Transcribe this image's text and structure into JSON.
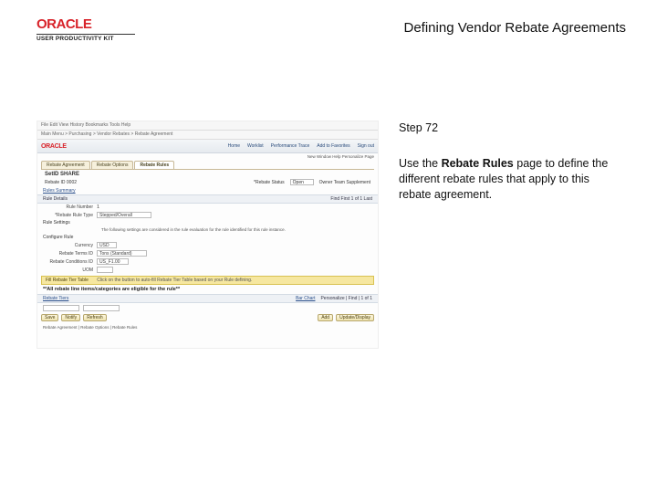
{
  "header": {
    "logo_text": "ORACLE",
    "upk_text": "USER PRODUCTIVITY KIT",
    "title": "Defining Vendor Rebate Agreements"
  },
  "instruction": {
    "step": "Step 72",
    "p1": "Use the ",
    "bold": "Rebate Rules",
    "p2": " page to define the different rebate rules that apply to this rebate agreement."
  },
  "app": {
    "menubar": "File   Edit   View   History   Bookmarks   Tools   Help",
    "breadcrumb": "Main Menu  >  Purchasing  >  Vendor Rebates  >  Rebate Agreement",
    "nav": [
      "Home",
      "Worklist",
      "Performance Trace",
      "Add to Favorites",
      "Sign out"
    ],
    "user_line": "New Window   Help   Personalize Page",
    "tabs": [
      "Rebate Agreement",
      "Rebate Options",
      "Rebate Rules"
    ],
    "edit_title": "SetID SHARE",
    "rebate_id": "Rebate ID  0002",
    "status_label": "*Rebate Status",
    "status_value": "Open",
    "origin_value": "Owner Team Supplement",
    "rules_summary": "Rules Summary",
    "rule_details": "Rule Details",
    "details_right": "Find   First   1 of 1   Last",
    "rule_number_label": "Rule Number",
    "rule_number_value": "1",
    "rule_type_label": "*Rebate Rule Type",
    "rule_type_value": "Stepped/Overall",
    "rule_settings": "Rule Settings",
    "settings_msg": "The following settings are considered in the rule evaluation for the rule identified for this rule instance.",
    "configure_rule": "Configure Rule",
    "currency_label": "Currency",
    "currency_value": "USD",
    "terms_label": "Rebate Terms ID",
    "terms_value": "Tons (Standard)",
    "cond_label": "Rebate Conditions ID",
    "cond_value": "US_F1.00",
    "uom_label": "UOM",
    "fill_bar": "Fill Rebate Tier Table",
    "fill_note": "Click on the button to auto-fill Rebate Tier Table based on your Rule defining.",
    "eligible": "**All rebate line items/categories are eligible for the rule**",
    "rebate_tiers_link": "Rebate Tiers",
    "bar_link": "Bar Chart",
    "bar_right": "Personalize | Find | 1 of 1",
    "buttons": [
      "Save",
      "Notify",
      "Refresh"
    ],
    "buttons2": [
      "Add",
      "Update/Display"
    ],
    "foot": "Rebate Agreement | Rebate Options | Rebate Rules"
  }
}
